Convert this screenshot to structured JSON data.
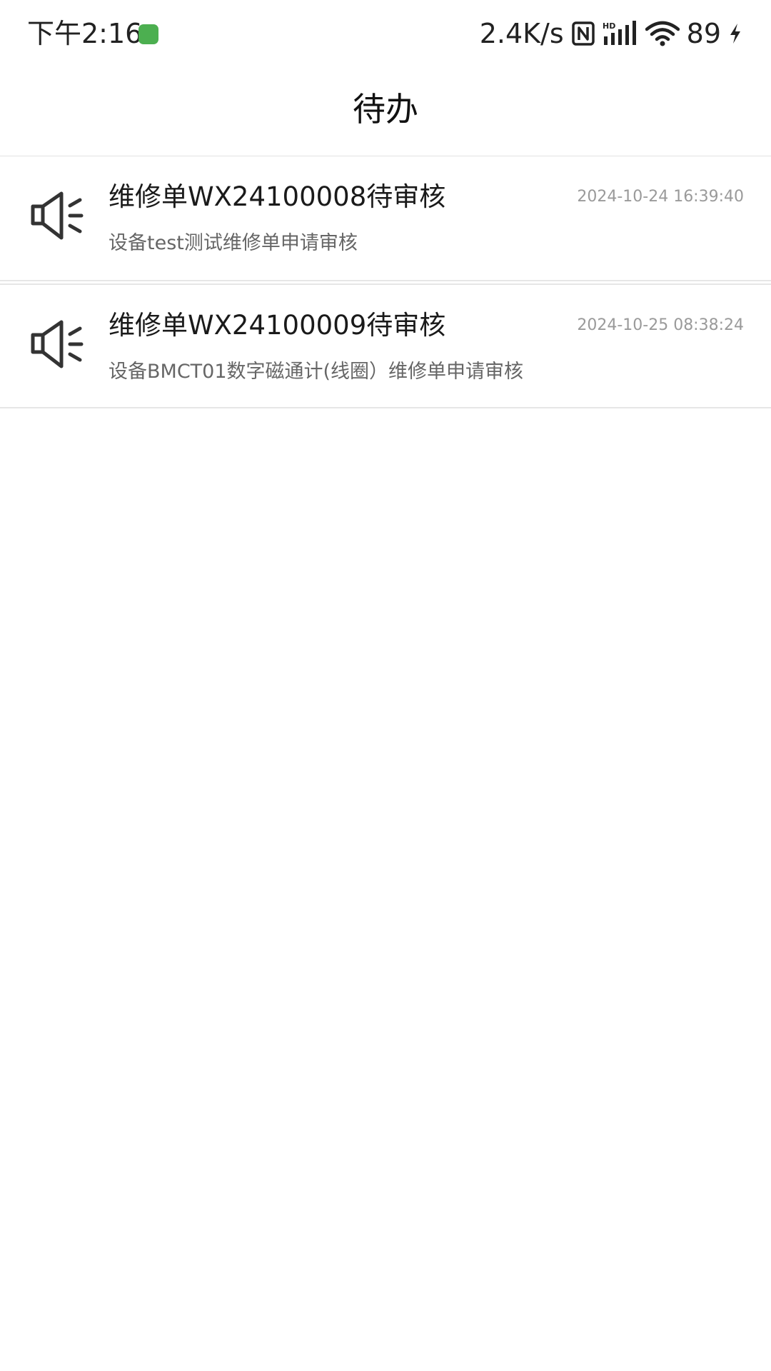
{
  "status_bar": {
    "time": "下午2:16",
    "network_speed": "2.4K/s",
    "battery": "89",
    "icons": [
      "app-notification-icon",
      "nfc-icon",
      "hd-signal-icon",
      "wifi-icon",
      "charging-icon"
    ]
  },
  "header": {
    "title": "待办"
  },
  "todos": [
    {
      "icon": "speaker-icon",
      "title": "维修单WX24100008待审核",
      "time": "2024-10-24 16:39:40",
      "desc": "设备test测试维修单申请审核"
    },
    {
      "icon": "speaker-icon",
      "title": "维修单WX24100009待审核",
      "time": "2024-10-25 08:38:24",
      "desc": "设备BMCT01数字磁通计(线圈）维修单申请审核"
    }
  ],
  "colors": {
    "accent_app_icon": "#4caf50",
    "text_primary": "#1a1a1a",
    "text_secondary": "#666666",
    "text_time": "#9a9a9a",
    "divider": "#e6e6e6"
  }
}
